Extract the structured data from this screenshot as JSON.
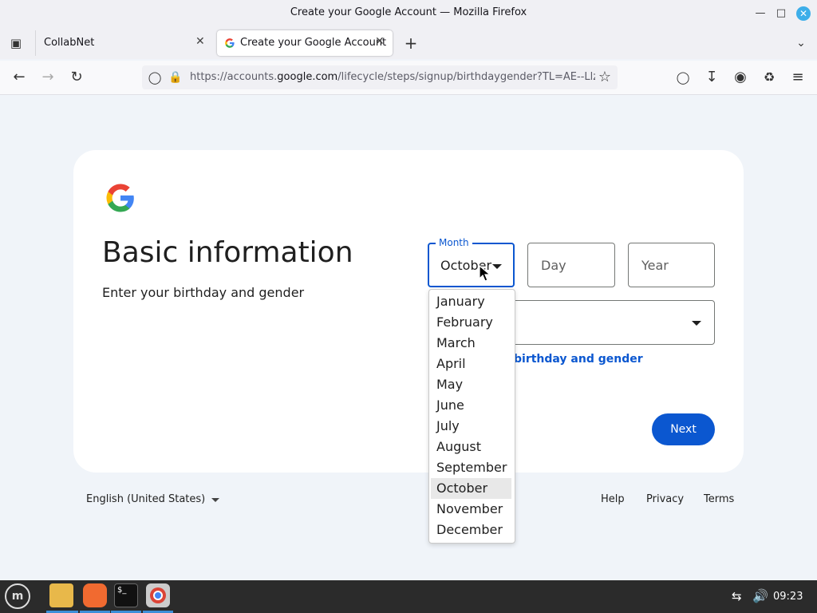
{
  "window": {
    "title": "Create your Google Account — Mozilla Firefox"
  },
  "tabs": [
    {
      "label": "CollabNet",
      "active": false
    },
    {
      "label": "Create your Google Account",
      "active": true
    }
  ],
  "navbar": {
    "url_prefix": "https://accounts.",
    "url_domain": "google.com",
    "url_path": "/lifecycle/steps/signup/birthdaygender?TL=AE--Llz2"
  },
  "page": {
    "heading": "Basic information",
    "subheading": "Enter your birthday and gender",
    "month": {
      "label": "Month",
      "value": "October"
    },
    "day": {
      "placeholder": "Day"
    },
    "year": {
      "placeholder": "Year"
    },
    "why_link": "birthday and gender",
    "next_label": "Next"
  },
  "dropdown": {
    "options": [
      "January",
      "February",
      "March",
      "April",
      "May",
      "June",
      "July",
      "August",
      "September",
      "October",
      "November",
      "December"
    ],
    "selected": "October"
  },
  "footer": {
    "language": "English (United States)",
    "links": [
      "Help",
      "Privacy",
      "Terms"
    ]
  },
  "taskbar": {
    "clock": "09:23"
  },
  "colors": {
    "accent": "#0b57d0",
    "page_bg": "#f0f4f9",
    "taskbar": "#2b2b2b"
  }
}
